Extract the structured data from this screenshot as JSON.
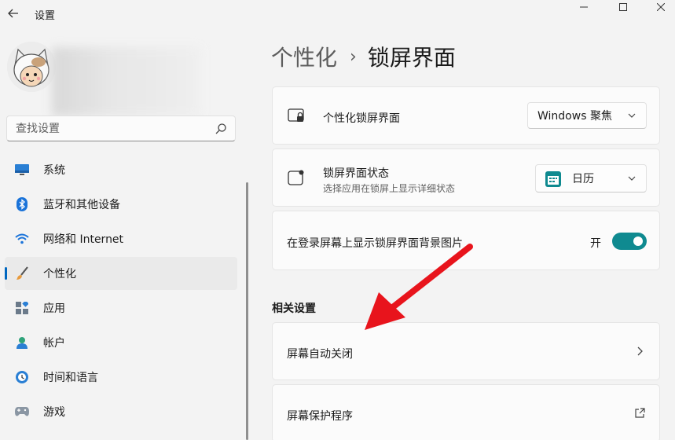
{
  "window": {
    "title": "设置",
    "back_icon": "back-arrow-icon",
    "controls": [
      "minimize-icon",
      "maximize-icon",
      "close-icon"
    ]
  },
  "sidebar": {
    "search_placeholder": "查找设置",
    "items": [
      {
        "label": "系统",
        "icon": "monitor-icon",
        "active": false
      },
      {
        "label": "蓝牙和其他设备",
        "icon": "bluetooth-icon",
        "active": false
      },
      {
        "label": "网络和 Internet",
        "icon": "wifi-icon",
        "active": false
      },
      {
        "label": "个性化",
        "icon": "brush-icon",
        "active": true
      },
      {
        "label": "应用",
        "icon": "apps-icon",
        "active": false
      },
      {
        "label": "帐户",
        "icon": "person-icon",
        "active": false
      },
      {
        "label": "时间和语言",
        "icon": "globe-clock-icon",
        "active": false
      },
      {
        "label": "游戏",
        "icon": "gamepad-icon",
        "active": false
      }
    ]
  },
  "breadcrumb": {
    "parent": "个性化",
    "separator": "›",
    "current": "锁屏界面"
  },
  "settings": {
    "personalize_lock": {
      "title": "个性化锁屏界面",
      "value": "Windows 聚焦"
    },
    "lock_status": {
      "title": "锁屏界面状态",
      "subtitle": "选择应用在锁屏上显示详细状态",
      "value": "日历"
    },
    "show_background": {
      "title": "在登录屏幕上显示锁屏界面背景图片",
      "state_label": "开",
      "on": true
    }
  },
  "related": {
    "title": "相关设置",
    "items": [
      {
        "label": "屏幕自动关闭",
        "action_icon": "chevron-right-icon"
      },
      {
        "label": "屏幕保护程序",
        "action_icon": "external-link-icon"
      }
    ]
  },
  "colors": {
    "accent": "#0067c0",
    "toggle_on": "#0f8a90",
    "annotation_arrow": "#e8141c"
  }
}
